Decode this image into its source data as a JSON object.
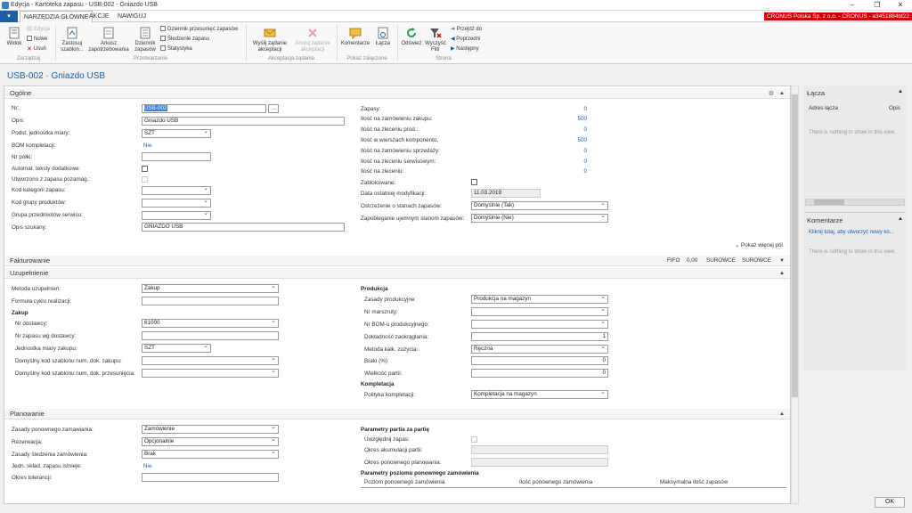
{
  "window": {
    "title": "Edycja - Kartoteka zapasu - USB-002 - Gniazdo USB",
    "minimize": "–",
    "maximize": "❐",
    "close": "✕"
  },
  "tabs": [
    "NARZĘDZIA GŁÓWNE",
    "AKCJE",
    "NAWIGUJ"
  ],
  "company": "CRONUS Polska Sp. z o.o. - CRONUS - a3451884bf22",
  "ribbon": {
    "widok": "Widok",
    "edycja": "Edycja",
    "nowe": "Nowe",
    "usun": "Usuń",
    "zarzadzaj": "Zarządzaj",
    "zastosuj": "Zastosuj szablon...",
    "arkusz": "Arkusz zapotrzebowania",
    "dziennik": "Dziennik zapasów",
    "dziennik_przes": "Dziennik przesunięć zapasów",
    "sledzenie": "Śledzenie zapasu",
    "statystyka": "Statystyka",
    "przetwarzanie": "Przetwarzanie",
    "wyslij": "Wyślij żądanie akceptacji",
    "anuluj": "Anuluj żądanie akceptacji",
    "akceptacja": "Akceptacja żądania",
    "komentarze": "Komentarze",
    "lacza": "Łącza",
    "pokaz_zalaczone": "Pokaż załączone",
    "odswiez": "Odśwież",
    "wyczysc": "Wyczyść Filtr",
    "przejdz": "Przejdź do",
    "poprzedni": "Poprzedni",
    "nastepny": "Następny",
    "strona": "Strona"
  },
  "page_title": "USB-002 · Gniazdo USB",
  "ogolne": {
    "header": "Ogólne",
    "nr_label": "Nr:",
    "nr": "USB-002",
    "nr_btn": "...",
    "opis_label": "Opis:",
    "opis": "Gniazdo USB",
    "jm_label": "Podst. jednostka miary:",
    "jm": "SZT",
    "bom_label": "BOM kompletacji:",
    "bom": "Nie",
    "polki_label": "Nr półki:",
    "autom_label": "Automat. teksty dodatkowe:",
    "utworzono_label": "Utworzono z zapasu pozamag.:",
    "kod_kat_label": "Kod kategorii zapasu:",
    "kod_grupy_label": "Kod grupy produktów:",
    "grupa_serw_label": "Grupa przedmiotów serwisu:",
    "opis_szuk_label": "Opis szukany:",
    "opis_szuk": "GNIAZDO USB",
    "zapasy_label": "Zapasy:",
    "zapasy": "0",
    "zam_zak_label": "Ilość na zamówieniu zakupu:",
    "zam_zak": "500",
    "zlec_prod_label": "Ilość na zleceniu prod.:",
    "zlec_prod": "0",
    "wiersz_komp_label": "Ilość w wierszach komponentu:",
    "wiersz_komp": "500",
    "zam_sprz_label": "Ilość na zamówieniu sprzedaży:",
    "zam_sprz": "0",
    "zlec_serw_label": "Ilość na zleceniu serwisowym:",
    "zlec_serw": "0",
    "zlec_label": "Ilość na zleceniu:",
    "zlec": "0",
    "zablok_label": "Zablokowane:",
    "data_mod_label": "Data ostatniej modyfikacji:",
    "data_mod": "11.03.2019",
    "ostrz_label": "Ostrzeżenie o stanach zapasów:",
    "ostrz": "Domyślnie (Tak)",
    "zapob_label": "Zapobieganie ujemnym stanom zapasów:",
    "zapob": "Domyślnie (Nie)",
    "pokaz_wiecej": "Pokaż więcej pól"
  },
  "fakturowanie": {
    "header": "Fakturowanie",
    "fifo": "FIFO",
    "val": "0,00",
    "s1": "SUROWCE",
    "s2": "SUROWCE"
  },
  "uzupelnienie": {
    "header": "Uzupełnienie",
    "metoda_label": "Metoda uzupełnień:",
    "metoda": "Zakup",
    "formula_label": "Formuła cyklu realizacji:",
    "zakup_hd": "Zakup",
    "nr_dost_label": "Nr dostawcy:",
    "nr_dost": "61000",
    "nr_zap_dost_label": "Nr zapasu wg dostawcy:",
    "jm_zak_label": "Jednostka miary zakupu:",
    "jm_zak": "SZT",
    "szab_zak_label": "Domyślny kod szablonu num. dok. zakupu:",
    "szab_przes_label": "Domyślny kod szablonu num. dok. przesunięcia:",
    "produkcja_hd": "Produkcja",
    "zasady_prod_label": "Zasady produkcyjne:",
    "zasady_prod": "Produkcja na magazyn",
    "marszruty_label": "Nr marszruty:",
    "bom_prod_label": "Nr BOM-u produkcyjnego:",
    "dokl_label": "Dokładność zaokrąglania:",
    "dokl": "1",
    "metoda_kalk_label": "Metoda kalk. zużycia:",
    "metoda_kalk": "Ręczna",
    "braki_label": "Braki (%):",
    "braki": "0",
    "wielkosc_label": "Wielkość partii:",
    "wielkosc": "0",
    "kompletacja_hd": "Kompletacja",
    "polityka_label": "Polityka kompletacji:",
    "polityka": "Kompletacja na magazyn"
  },
  "planowanie": {
    "header": "Planowanie",
    "zasady_label": "Zasady ponownego zamawiania:",
    "zasady": "Zamówienie",
    "rezerwacja_label": "Rezerwacja:",
    "rezerwacja": "Opcjonalnie",
    "sledzenie_label": "Zasady śledzenia zamówienia:",
    "sledzenie": "Brak",
    "jedn_label": "Jedn. skład. zapasu istnieje:",
    "jedn": "Nie",
    "okres_tol_label": "Okres tolerancji:",
    "param_partia_hd": "Parametry partia za partię",
    "uwzgl_label": "Uwzględnij zapas:",
    "okres_akum_label": "Okres akumulacji partii:",
    "okres_pon_label": "Okres ponownego planowania:",
    "param_poziom_hd": "Parametry poziomu ponownego zamówienia",
    "col1": "Poziom ponownego zamówienia",
    "col2": "Ilość ponownego zamówienia",
    "col3": "Maksymalna ilość zapasów"
  },
  "side": {
    "lacza_hd": "Łącza",
    "adres": "Adres łącza",
    "opis": "Opis",
    "nothing1": "There is nothing to show in this view.",
    "komentarze_hd": "Komentarze",
    "kliknij": "Kliknij tutaj, aby utworzyć nowy ko...",
    "nothing2": "There is nothing to show in this view."
  },
  "ok": "OK"
}
